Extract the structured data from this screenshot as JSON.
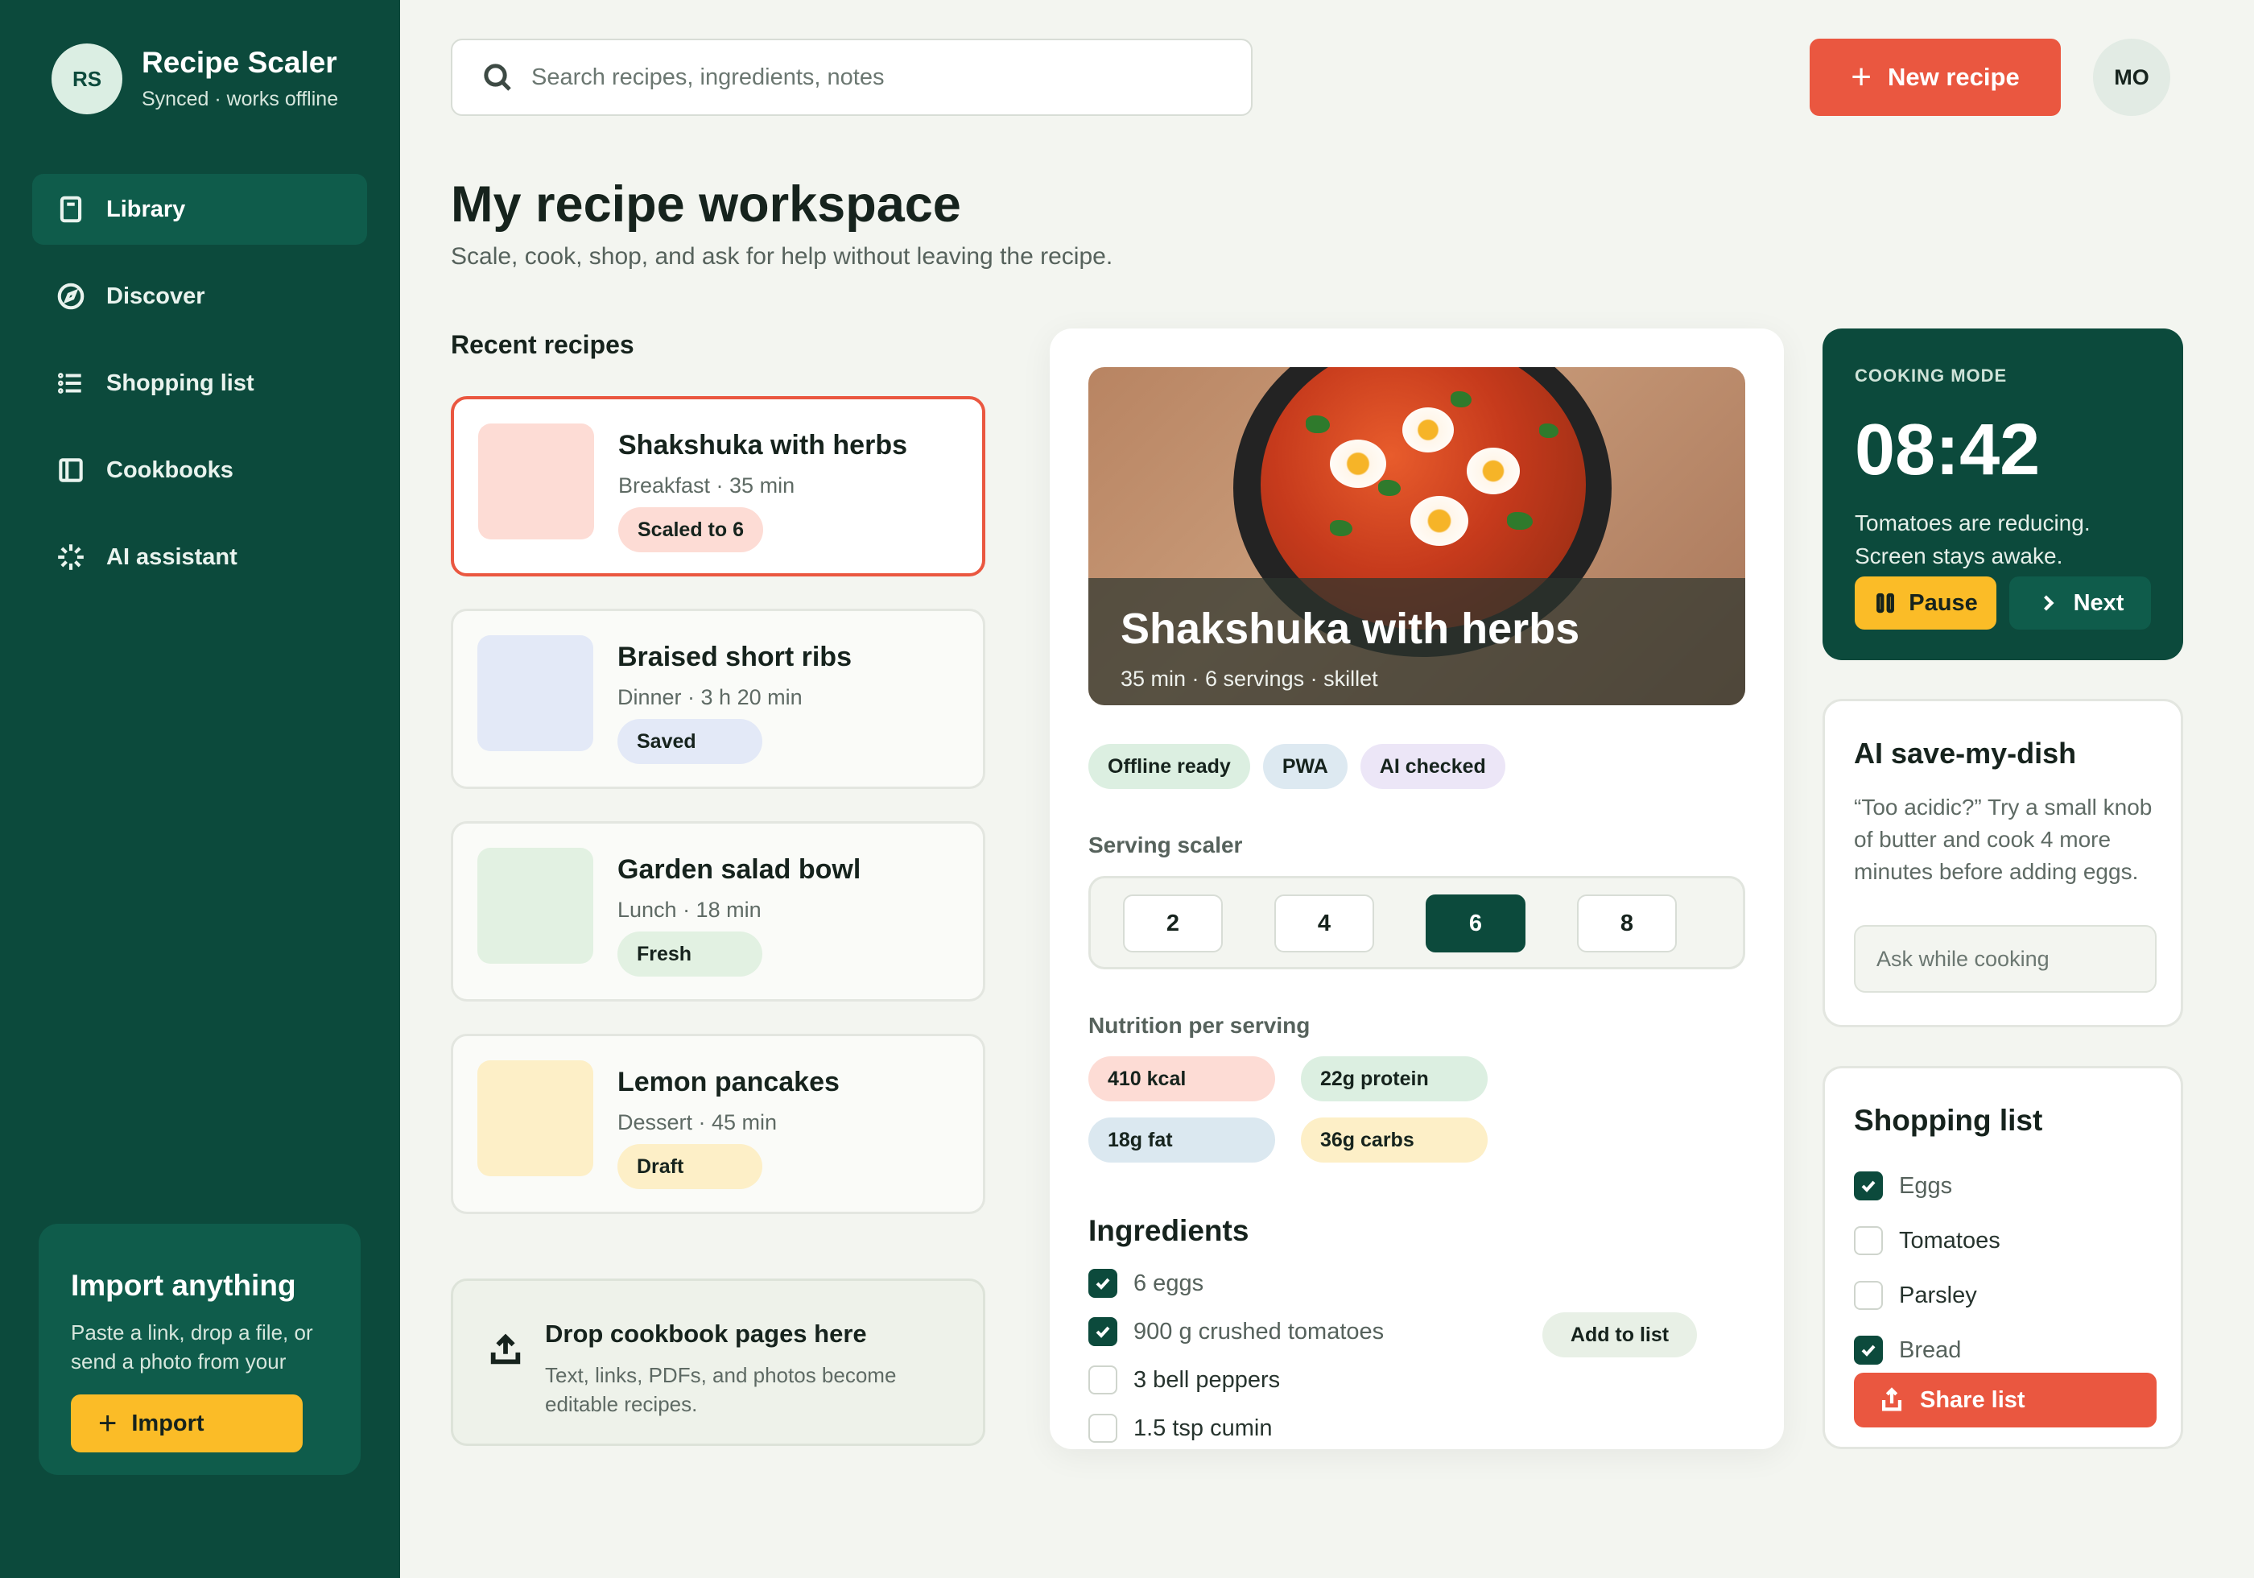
{
  "brand": {
    "initials": "RS",
    "title": "Recipe Scaler",
    "subtitle": "Synced · works offline"
  },
  "nav": [
    {
      "label": "Library",
      "icon": "book-icon",
      "active": true
    },
    {
      "label": "Discover",
      "icon": "compass-icon",
      "active": false
    },
    {
      "label": "Shopping list",
      "icon": "list-icon",
      "active": false
    },
    {
      "label": "Cookbooks",
      "icon": "cookbook-icon",
      "active": false
    },
    {
      "label": "AI assistant",
      "icon": "sparkle-icon",
      "active": false
    }
  ],
  "import": {
    "title": "Import anything",
    "description": "Paste a link, drop a file, or send a photo from your phone.",
    "button": "Import"
  },
  "search": {
    "placeholder": "Search recipes, ingredients, notes"
  },
  "header": {
    "new_recipe": "New recipe",
    "user_initials": "MO"
  },
  "page": {
    "title": "My recipe workspace",
    "subtitle": "Scale, cook, shop, and ask for help without leaving the recipe."
  },
  "recent": {
    "title": "Recent recipes",
    "items": [
      {
        "name": "Shakshuka with herbs",
        "meta": "Breakfast · 35 min",
        "badge": "Scaled to 6",
        "thumb_color": "#fddcd5",
        "badge_color": "#fddcd5",
        "selected": true
      },
      {
        "name": "Braised short ribs",
        "meta": "Dinner · 3 h 20 min",
        "badge": "Saved",
        "thumb_color": "#e3e9f7",
        "badge_color": "#e3e9f7",
        "selected": false
      },
      {
        "name": "Garden salad bowl",
        "meta": "Lunch · 18 min",
        "badge": "Fresh",
        "thumb_color": "#e2f1e2",
        "badge_color": "#e2f1e2",
        "selected": false
      },
      {
        "name": "Lemon pancakes",
        "meta": "Dessert · 45 min",
        "badge": "Draft",
        "thumb_color": "#fdefc7",
        "badge_color": "#fdefc7",
        "selected": false
      }
    ]
  },
  "drop": {
    "title": "Drop cookbook pages here",
    "description": "Text, links, PDFs, and photos become editable recipes."
  },
  "detail": {
    "title": "Shakshuka with herbs",
    "meta": "35 min · 6 servings · skillet",
    "tags": [
      {
        "label": "Offline ready",
        "color": "#dcefe1"
      },
      {
        "label": "PWA",
        "color": "#dde9f1"
      },
      {
        "label": "AI checked",
        "color": "#ece6f7"
      }
    ],
    "scaler_label": "Serving scaler",
    "servings": [
      "2",
      "4",
      "6",
      "8"
    ],
    "selected_serving": "6",
    "nutrition_label": "Nutrition per serving",
    "nutrition": [
      {
        "label": "410 kcal",
        "color": "#fddcd5"
      },
      {
        "label": "22g protein",
        "color": "#dcefe1"
      },
      {
        "label": "18g fat",
        "color": "#dbe8f0"
      },
      {
        "label": "36g carbs",
        "color": "#fdefc7"
      }
    ],
    "ingredients_title": "Ingredients",
    "ingredients": [
      {
        "label": "6 eggs",
        "checked": true
      },
      {
        "label": "900 g crushed tomatoes",
        "checked": true
      },
      {
        "label": "3 bell peppers",
        "checked": false
      },
      {
        "label": "1.5 tsp cumin",
        "checked": false
      }
    ],
    "add_to_list": "Add to list"
  },
  "cooking": {
    "label": "COOKING MODE",
    "time": "08:42",
    "description": "Tomatoes are reducing. Screen stays awake.",
    "pause": "Pause",
    "next": "Next"
  },
  "ai": {
    "title": "AI save-my-dish",
    "description": "“Too acidic?” Try a small knob of butter and cook 4 more minutes before adding eggs.",
    "placeholder": "Ask while cooking"
  },
  "shopping": {
    "title": "Shopping list",
    "items": [
      {
        "label": "Eggs",
        "checked": true
      },
      {
        "label": "Tomatoes",
        "checked": false
      },
      {
        "label": "Parsley",
        "checked": false
      },
      {
        "label": "Bread",
        "checked": true
      }
    ],
    "share": "Share list"
  }
}
